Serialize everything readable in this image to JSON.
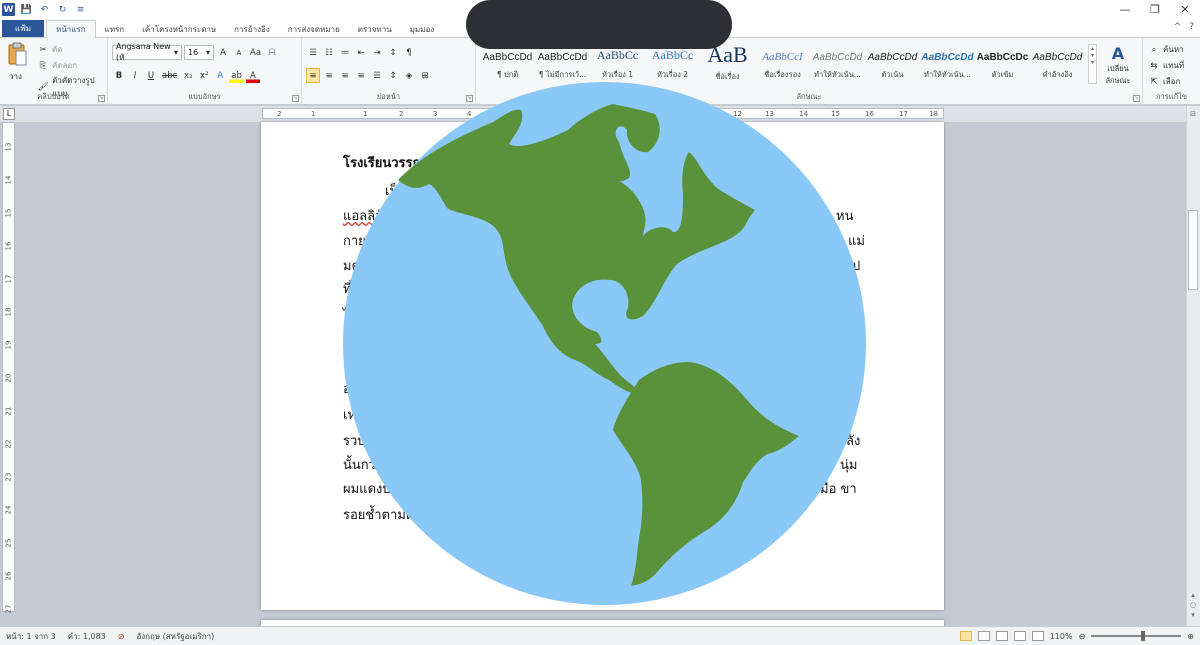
{
  "titlebar": {
    "logo": "W",
    "save": "💾",
    "undo": "↶",
    "redo": "↻",
    "qat_more": "≡",
    "min": "—",
    "restore": "❐",
    "close": "✕"
  },
  "tabs": {
    "file": "แฟ้ม",
    "items": [
      "หน้าแรก",
      "แทรก",
      "เค้าโครงหน้ากระดาษ",
      "การอ้างอิง",
      "การส่งจดหมาย",
      "ตรวจทาน",
      "มุมมอง"
    ],
    "collapse": "^",
    "help": "?"
  },
  "clipboard": {
    "paste": "วาง",
    "cut": "ตัด",
    "copy": "คัดลอก",
    "format_painter": "ตัวคัดวางรูปแบบ",
    "label": "คลิปบอร์ด"
  },
  "font": {
    "name": "Angsana New (หั",
    "size": "16",
    "grow": "A",
    "shrink": "A",
    "case": "Aa",
    "clear": "ᗩ",
    "bold": "B",
    "italic": "I",
    "underline": "U",
    "strike": "abc",
    "sub": "x₂",
    "sup": "x²",
    "effects": "A",
    "highlight": "ab",
    "color": "A",
    "label": "แบบอักษร"
  },
  "paragraph": {
    "bullets": "☰",
    "numbering": "☷",
    "multilevel": "≔",
    "dec_indent": "⇤",
    "inc_indent": "⇥",
    "sort": "↕",
    "marks": "¶",
    "align_left": "≡",
    "align_center": "≡",
    "align_right": "≡",
    "justify": "≡",
    "distributed": "☰",
    "spacing": "↕",
    "shading": "◈",
    "borders": "⊞",
    "label": "ย่อหน้า"
  },
  "styles": {
    "items": [
      {
        "sample": "AaBbCcDd",
        "name": "¶ ปกติ"
      },
      {
        "sample": "AaBbCcDd",
        "name": "¶ ไม่มีการเว้..."
      },
      {
        "sample": "AaBbCc",
        "name": "หัวเรื่อง 1"
      },
      {
        "sample": "AaBbCc",
        "name": "หัวเรื่อง 2"
      },
      {
        "sample": "AaB",
        "name": "ชื่อเรื่อง"
      },
      {
        "sample": "AaBbCcI",
        "name": "ชื่อเรื่องรอง"
      },
      {
        "sample": "AaBbCcDd",
        "name": "ทำให้หัวเน้น..."
      },
      {
        "sample": "AaBbCcDd",
        "name": "ตัวเน้น"
      },
      {
        "sample": "AaBbCcDd",
        "name": "ทำให้หัวเน้น..."
      },
      {
        "sample": "AaBbCcDc",
        "name": "ตัวเข้ม"
      },
      {
        "sample": "AaBbCcDd",
        "name": "คำอ้างอิง"
      }
    ],
    "change_styles": "เปลี่ยน ลักษณะ",
    "change_icon": "A",
    "label": "ลักษณะ"
  },
  "editing": {
    "find": "ค้นหา",
    "replace": "แทนที่",
    "select": "เลือก",
    "label": "การแก้ไข"
  },
  "ruler": {
    "ticks": [
      "2",
      "1",
      "1",
      "2",
      "3",
      "4",
      "12",
      "13",
      "14",
      "15",
      "16",
      "17",
      "18"
    ],
    "vticks": [
      "13",
      "14",
      "15",
      "16",
      "17",
      "18",
      "19",
      "20",
      "21",
      "22",
      "23",
      "24",
      "25",
      "26",
      "27"
    ],
    "corner": "L"
  },
  "document": {
    "lines": [
      "โรงเรียนวรรณ",
      "เป็",
      "แอลลิสั",
      "กาย",
      "มด",
      "ที่",
      "ไ",
      "อ",
      "เห",
      "รวบ",
      "นั้นกว",
      "ผมแดงบ",
      "รอยช้ำตามต",
      "หน",
      "แม่",
      "ป",
      "ลัง",
      "นุ่ม",
      "มือ ขา"
    ]
  },
  "status": {
    "page": "หน้า: 1 จาก 3",
    "words": "คำ: 1,083",
    "proof": "⊘",
    "language": "อังกฤษ (สหรัฐอเมริกา)",
    "zoom": "110%",
    "zoom_out": "⊖",
    "zoom_in": "⊕"
  },
  "colors": {
    "ocean": "#8ac8f7",
    "land": "#5a923c",
    "accent": "#2b579a",
    "redaction": "#2d2f33"
  }
}
